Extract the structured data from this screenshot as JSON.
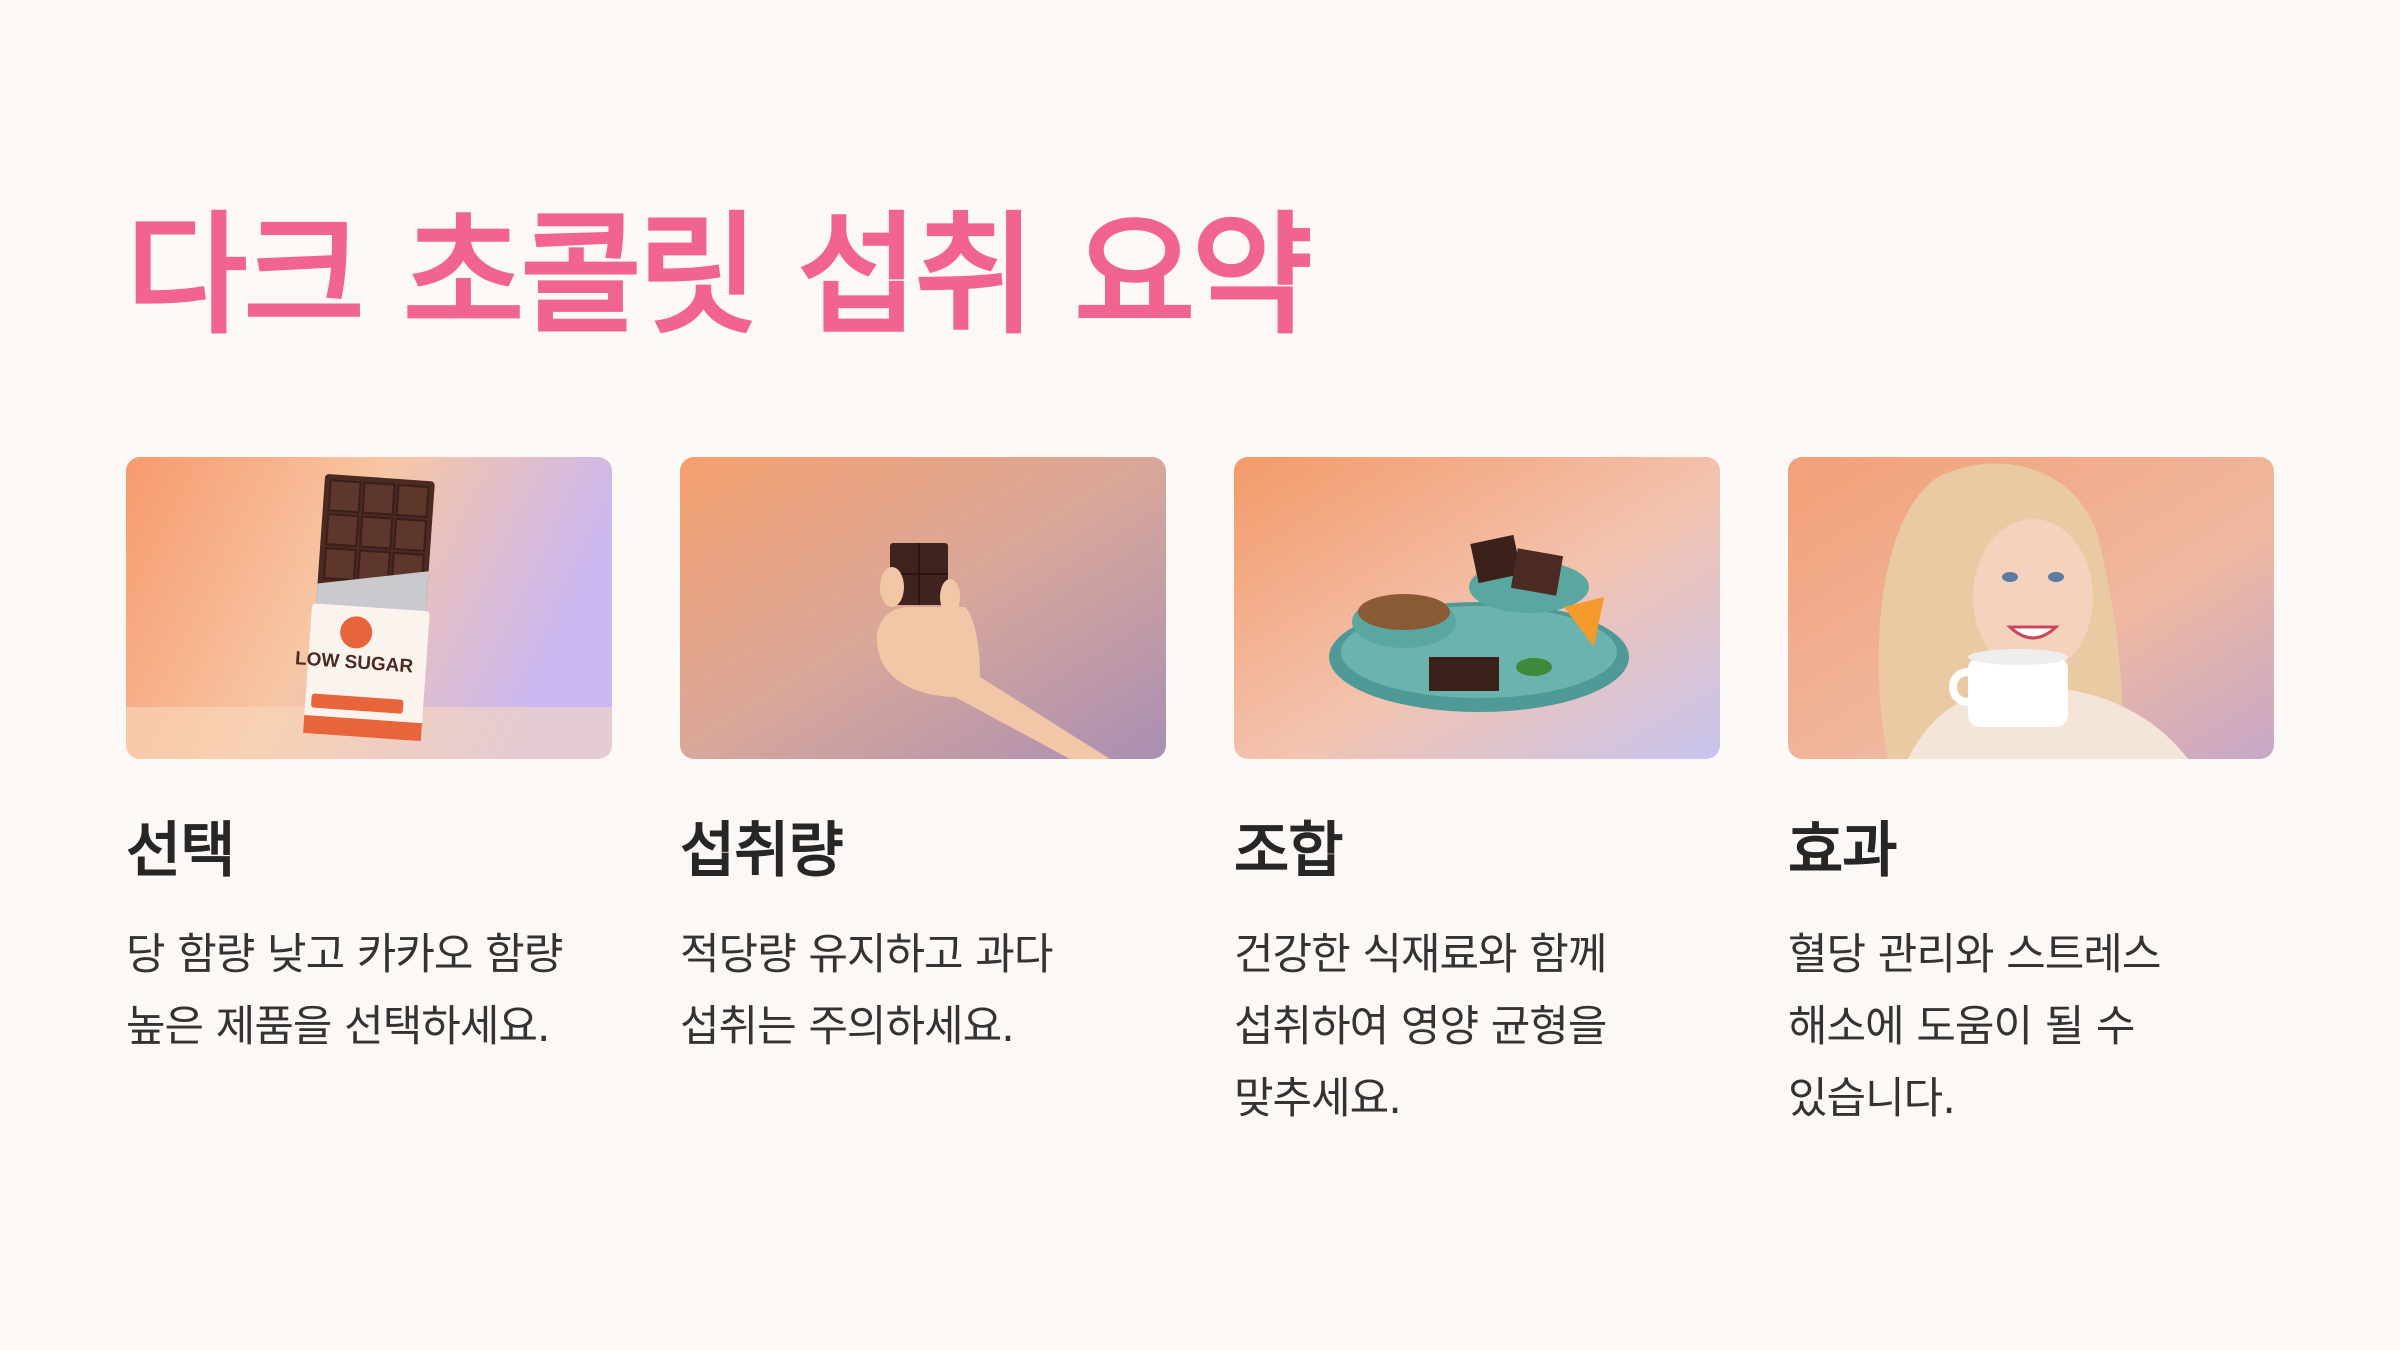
{
  "slide": {
    "title": "다크 초콜릿 섭취 요약"
  },
  "cards": [
    {
      "title": "선택",
      "description": "당 함량 낮고 카카오 함량 높은 제품을 선택하세요.",
      "image_label": "LOW SUGAR",
      "image_icon": "chocolate-bar-low-sugar-image"
    },
    {
      "title": "섭취량",
      "description": "적당량 유지하고 과다 섭취는 주의하세요.",
      "image_icon": "hand-holding-chocolate-image"
    },
    {
      "title": "조합",
      "description": "건강한 식재료와 함께 섭취하여 영양 균형을 맞추세요.",
      "image_icon": "chocolate-nuts-plate-image"
    },
    {
      "title": "효과",
      "description": "혈당 관리와 스트레스 해소에 도움이 될 수 있습니다.",
      "image_icon": "smiling-woman-with-cup-image"
    }
  ],
  "colors": {
    "background": "#fcf8f5",
    "title": "#f0648f",
    "text": "#2b2b2b"
  }
}
